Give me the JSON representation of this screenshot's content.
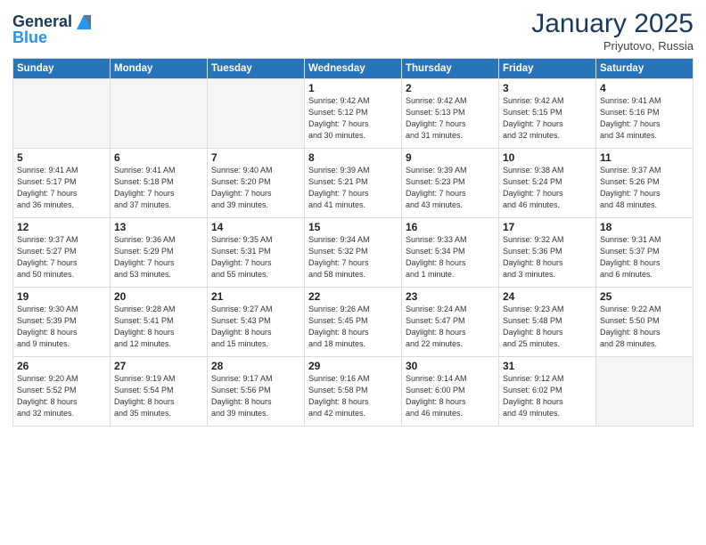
{
  "header": {
    "logo_line1": "General",
    "logo_line2": "Blue",
    "month_year": "January 2025",
    "location": "Priyutovo, Russia"
  },
  "weekdays": [
    "Sunday",
    "Monday",
    "Tuesday",
    "Wednesday",
    "Thursday",
    "Friday",
    "Saturday"
  ],
  "weeks": [
    [
      {
        "day": "",
        "info": ""
      },
      {
        "day": "",
        "info": ""
      },
      {
        "day": "",
        "info": ""
      },
      {
        "day": "1",
        "info": "Sunrise: 9:42 AM\nSunset: 5:12 PM\nDaylight: 7 hours\nand 30 minutes."
      },
      {
        "day": "2",
        "info": "Sunrise: 9:42 AM\nSunset: 5:13 PM\nDaylight: 7 hours\nand 31 minutes."
      },
      {
        "day": "3",
        "info": "Sunrise: 9:42 AM\nSunset: 5:15 PM\nDaylight: 7 hours\nand 32 minutes."
      },
      {
        "day": "4",
        "info": "Sunrise: 9:41 AM\nSunset: 5:16 PM\nDaylight: 7 hours\nand 34 minutes."
      }
    ],
    [
      {
        "day": "5",
        "info": "Sunrise: 9:41 AM\nSunset: 5:17 PM\nDaylight: 7 hours\nand 36 minutes."
      },
      {
        "day": "6",
        "info": "Sunrise: 9:41 AM\nSunset: 5:18 PM\nDaylight: 7 hours\nand 37 minutes."
      },
      {
        "day": "7",
        "info": "Sunrise: 9:40 AM\nSunset: 5:20 PM\nDaylight: 7 hours\nand 39 minutes."
      },
      {
        "day": "8",
        "info": "Sunrise: 9:39 AM\nSunset: 5:21 PM\nDaylight: 7 hours\nand 41 minutes."
      },
      {
        "day": "9",
        "info": "Sunrise: 9:39 AM\nSunset: 5:23 PM\nDaylight: 7 hours\nand 43 minutes."
      },
      {
        "day": "10",
        "info": "Sunrise: 9:38 AM\nSunset: 5:24 PM\nDaylight: 7 hours\nand 46 minutes."
      },
      {
        "day": "11",
        "info": "Sunrise: 9:37 AM\nSunset: 5:26 PM\nDaylight: 7 hours\nand 48 minutes."
      }
    ],
    [
      {
        "day": "12",
        "info": "Sunrise: 9:37 AM\nSunset: 5:27 PM\nDaylight: 7 hours\nand 50 minutes."
      },
      {
        "day": "13",
        "info": "Sunrise: 9:36 AM\nSunset: 5:29 PM\nDaylight: 7 hours\nand 53 minutes."
      },
      {
        "day": "14",
        "info": "Sunrise: 9:35 AM\nSunset: 5:31 PM\nDaylight: 7 hours\nand 55 minutes."
      },
      {
        "day": "15",
        "info": "Sunrise: 9:34 AM\nSunset: 5:32 PM\nDaylight: 7 hours\nand 58 minutes."
      },
      {
        "day": "16",
        "info": "Sunrise: 9:33 AM\nSunset: 5:34 PM\nDaylight: 8 hours\nand 1 minute."
      },
      {
        "day": "17",
        "info": "Sunrise: 9:32 AM\nSunset: 5:36 PM\nDaylight: 8 hours\nand 3 minutes."
      },
      {
        "day": "18",
        "info": "Sunrise: 9:31 AM\nSunset: 5:37 PM\nDaylight: 8 hours\nand 6 minutes."
      }
    ],
    [
      {
        "day": "19",
        "info": "Sunrise: 9:30 AM\nSunset: 5:39 PM\nDaylight: 8 hours\nand 9 minutes."
      },
      {
        "day": "20",
        "info": "Sunrise: 9:28 AM\nSunset: 5:41 PM\nDaylight: 8 hours\nand 12 minutes."
      },
      {
        "day": "21",
        "info": "Sunrise: 9:27 AM\nSunset: 5:43 PM\nDaylight: 8 hours\nand 15 minutes."
      },
      {
        "day": "22",
        "info": "Sunrise: 9:26 AM\nSunset: 5:45 PM\nDaylight: 8 hours\nand 18 minutes."
      },
      {
        "day": "23",
        "info": "Sunrise: 9:24 AM\nSunset: 5:47 PM\nDaylight: 8 hours\nand 22 minutes."
      },
      {
        "day": "24",
        "info": "Sunrise: 9:23 AM\nSunset: 5:48 PM\nDaylight: 8 hours\nand 25 minutes."
      },
      {
        "day": "25",
        "info": "Sunrise: 9:22 AM\nSunset: 5:50 PM\nDaylight: 8 hours\nand 28 minutes."
      }
    ],
    [
      {
        "day": "26",
        "info": "Sunrise: 9:20 AM\nSunset: 5:52 PM\nDaylight: 8 hours\nand 32 minutes."
      },
      {
        "day": "27",
        "info": "Sunrise: 9:19 AM\nSunset: 5:54 PM\nDaylight: 8 hours\nand 35 minutes."
      },
      {
        "day": "28",
        "info": "Sunrise: 9:17 AM\nSunset: 5:56 PM\nDaylight: 8 hours\nand 39 minutes."
      },
      {
        "day": "29",
        "info": "Sunrise: 9:16 AM\nSunset: 5:58 PM\nDaylight: 8 hours\nand 42 minutes."
      },
      {
        "day": "30",
        "info": "Sunrise: 9:14 AM\nSunset: 6:00 PM\nDaylight: 8 hours\nand 46 minutes."
      },
      {
        "day": "31",
        "info": "Sunrise: 9:12 AM\nSunset: 6:02 PM\nDaylight: 8 hours\nand 49 minutes."
      },
      {
        "day": "",
        "info": ""
      }
    ]
  ]
}
